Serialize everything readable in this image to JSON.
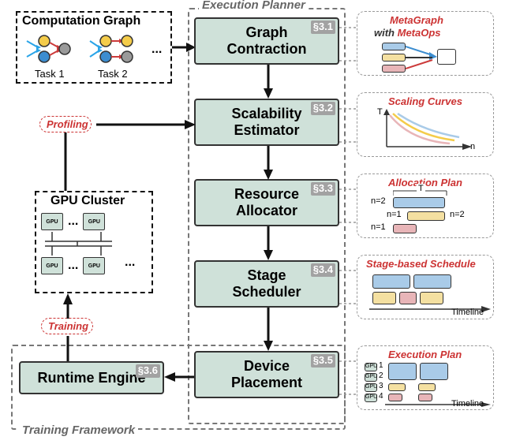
{
  "planner": {
    "title": "Execution Planner",
    "stages": {
      "graph_contraction": {
        "label": "Graph\nContraction",
        "section": "§3.1"
      },
      "scalability": {
        "label": "Scalability\nEstimator",
        "section": "§3.2"
      },
      "resource": {
        "label": "Resource\nAllocator",
        "section": "§3.3"
      },
      "stage_sched": {
        "label": "Stage\nScheduler",
        "section": "§3.4"
      },
      "device": {
        "label": "Device\nPlacement",
        "section": "§3.5"
      }
    }
  },
  "framework": {
    "title": "Training Framework",
    "runtime": {
      "label": "Runtime Engine",
      "section": "§3.6"
    }
  },
  "computation_graph": {
    "title": "Computation Graph",
    "task1": "Task 1",
    "task2": "Task 2",
    "ellipsis": "..."
  },
  "pills": {
    "profiling": "Profiling",
    "training": "Training"
  },
  "gpu": {
    "title": "GPU Cluster",
    "chip": "GPU",
    "ellipsis": "...",
    "more": "..."
  },
  "outputs": {
    "metagraph": {
      "title1": "MetaGraph",
      "title2": "with ",
      "title3": "MetaOps"
    },
    "scaling": {
      "title": "Scaling Curves",
      "ylabel": "T",
      "xlabel": "n"
    },
    "allocation": {
      "title": "Allocation Plan",
      "tlabel": "T",
      "n2a": "n=2",
      "n1a": "n=1",
      "n2b": "n=2",
      "n1b": "n=1"
    },
    "schedule": {
      "title": "Stage-based Schedule",
      "timeline": "Timeline"
    },
    "execution": {
      "title": "Execution Plan",
      "timeline": "Timeline",
      "d1": "1",
      "d2": "2",
      "d3": "3",
      "d4": "4",
      "gpu": "GPU"
    }
  }
}
